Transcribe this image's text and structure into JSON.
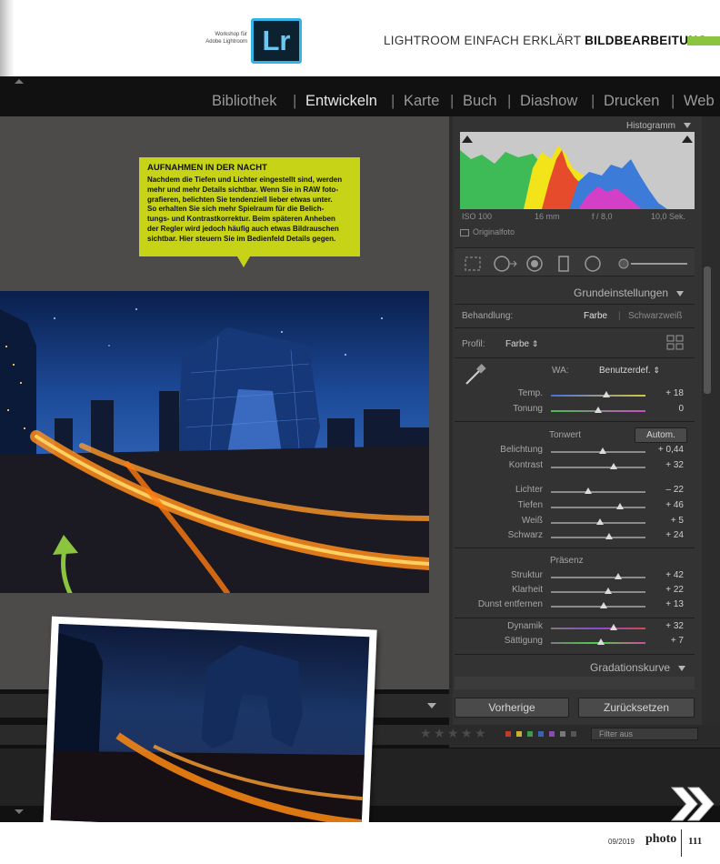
{
  "magazine": {
    "caption_line1": "Workshop für",
    "caption_line2": "Adobe Lightroom",
    "logo_text": "Lr",
    "title_main": "LIGHTROOM EINFACH ERKLÄRT",
    "title_bold": "BILDBEARBEITUNG",
    "footer_date": "09/2019",
    "footer_brand": "photo",
    "footer_page": "111",
    "accent_color": "#8bc43f"
  },
  "modules": [
    {
      "label": "Bibliothek",
      "active": false
    },
    {
      "label": "Entwickeln",
      "active": true
    },
    {
      "label": "Karte",
      "active": false
    },
    {
      "label": "Buch",
      "active": false
    },
    {
      "label": "Diashow",
      "active": false
    },
    {
      "label": "Drucken",
      "active": false
    },
    {
      "label": "Web",
      "active": false
    }
  ],
  "module_separator": "|",
  "callout": {
    "title": "AUFNAHMEN IN DER NACHT",
    "lines": [
      "Nachdem die Tiefen und Lichter eingestellt sind, werden",
      "mehr und mehr Details sichtbar. Wenn Sie in RAW foto-",
      "grafieren, belichten Sie tendenziell lieber etwas unter.",
      "So erhalten Sie sich mehr Spielraum für die Belich-",
      "tungs- und Kontrastkorrektur. Beim späteren Anheben",
      "der Regler wird jedoch häufig auch etwas Bildrauschen",
      "sichtbar. Hier steuern Sie im Bedienfeld Details gegen."
    ],
    "color": "#c6d317"
  },
  "histogram": {
    "title": "Histogramm",
    "iso": "ISO 100",
    "focal": "16 mm",
    "aperture": "f / 8,0",
    "shutter": "10,0 Sek.",
    "original_label": "Originalfoto"
  },
  "basic": {
    "title": "Grundeinstellungen",
    "treatment_label": "Behandlung:",
    "treatment_color": "Farbe",
    "treatment_bw": "Schwarzweiß",
    "profile_label": "Profil:",
    "profile_value": "Farbe",
    "profile_arrows": "⇕",
    "wb_label": "WA:",
    "wb_value": "Benutzerdef.",
    "tone_label": "Tonwert",
    "auto_label": "Autom.",
    "presence_label": "Präsenz"
  },
  "sliders": [
    {
      "label": "Temp.",
      "value": "+ 18",
      "pos": 0.59,
      "track": "temp"
    },
    {
      "label": "Tonung",
      "value": "0",
      "pos": 0.5,
      "track": "tint"
    },
    {
      "label": "Belichtung",
      "value": "+ 0,44",
      "pos": 0.55,
      "track": "gray"
    },
    {
      "label": "Kontrast",
      "value": "+ 32",
      "pos": 0.66,
      "track": "gray"
    },
    {
      "label": "Lichter",
      "value": "– 22",
      "pos": 0.39,
      "track": "gray"
    },
    {
      "label": "Tiefen",
      "value": "+ 46",
      "pos": 0.73,
      "track": "gray"
    },
    {
      "label": "Weiß",
      "value": "+ 5",
      "pos": 0.52,
      "track": "gray"
    },
    {
      "label": "Schwarz",
      "value": "+ 24",
      "pos": 0.62,
      "track": "gray"
    },
    {
      "label": "Struktur",
      "value": "+ 42",
      "pos": 0.71,
      "track": "gray"
    },
    {
      "label": "Klarheit",
      "value": "+ 22",
      "pos": 0.61,
      "track": "gray"
    },
    {
      "label": "Dunst entfernen",
      "value": "+ 13",
      "pos": 0.56,
      "track": "gray"
    },
    {
      "label": "Dynamik",
      "value": "+ 32",
      "pos": 0.66,
      "track": "vib"
    },
    {
      "label": "Sättigung",
      "value": "+ 7",
      "pos": 0.53,
      "track": "sat"
    }
  ],
  "tone_curve": {
    "title": "Gradationskurve"
  },
  "buttons": {
    "previous": "Vorherige",
    "reset": "Zurücksetzen"
  },
  "filter": {
    "label": "Filter aus"
  }
}
